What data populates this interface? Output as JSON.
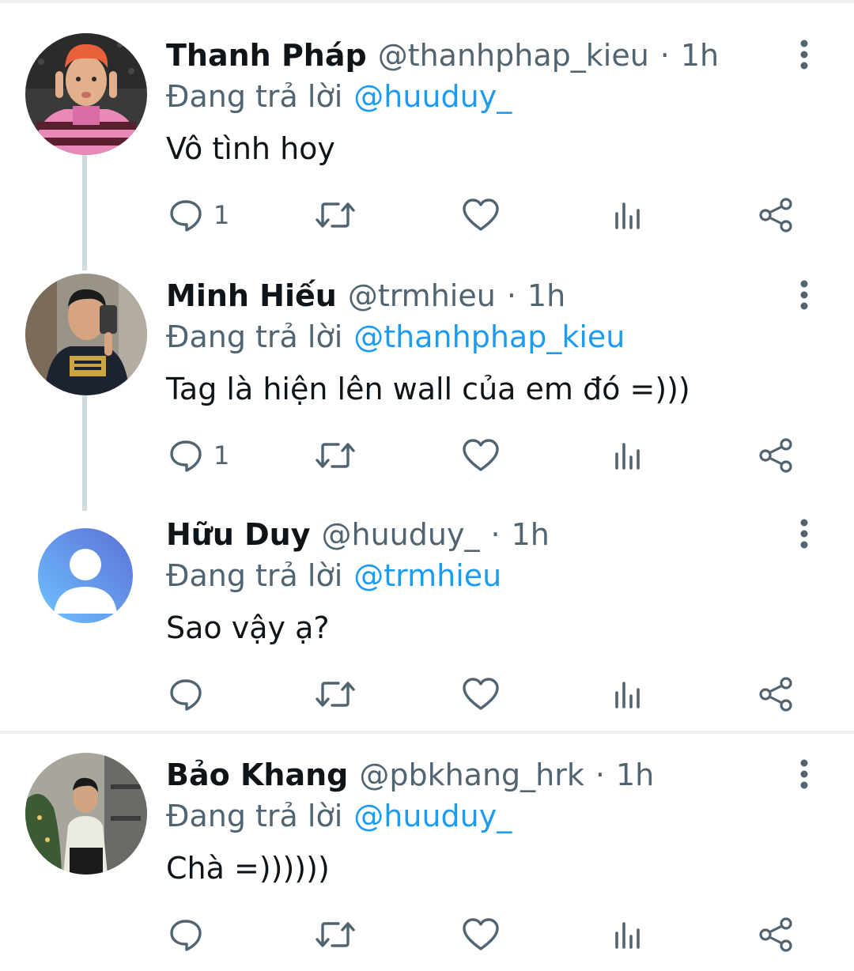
{
  "icons": {
    "more": "more-vertical-icon",
    "reply": "reply-icon",
    "retweet": "retweet-icon",
    "like": "like-icon",
    "views": "views-icon",
    "share": "share-icon"
  },
  "colors": {
    "text_primary": "#0f1419",
    "text_secondary": "#536471",
    "accent": "#1d9bf0",
    "thread_line": "#cfd9de"
  },
  "tweets": [
    {
      "display_name": "Thanh Pháp",
      "handle": "@thanhphap_kieu",
      "dot": "·",
      "time": "1h",
      "reply_prefix": "Đang trả lời",
      "reply_to": "@huuduy_",
      "text": "Vô tình hoy",
      "reply_count": "1"
    },
    {
      "display_name": "Minh Hiếu",
      "handle": "@trmhieu",
      "dot": "·",
      "time": "1h",
      "reply_prefix": "Đang trả lời",
      "reply_to": "@thanhphap_kieu",
      "text": "Tag là hiện lên wall của em đó =)))",
      "reply_count": "1"
    },
    {
      "display_name": "Hữu Duy",
      "handle": "@huuduy_",
      "dot": "·",
      "time": "1h",
      "reply_prefix": "Đang trả lời",
      "reply_to": "@trmhieu",
      "text": "Sao vậy ạ?",
      "reply_count": ""
    },
    {
      "display_name": "Bảo Khang",
      "handle": "@pbkhang_hrk",
      "dot": "·",
      "time": "1h",
      "reply_prefix": "Đang trả lời",
      "reply_to": "@huuduy_",
      "text": "Chà =))))))",
      "reply_count": ""
    }
  ]
}
